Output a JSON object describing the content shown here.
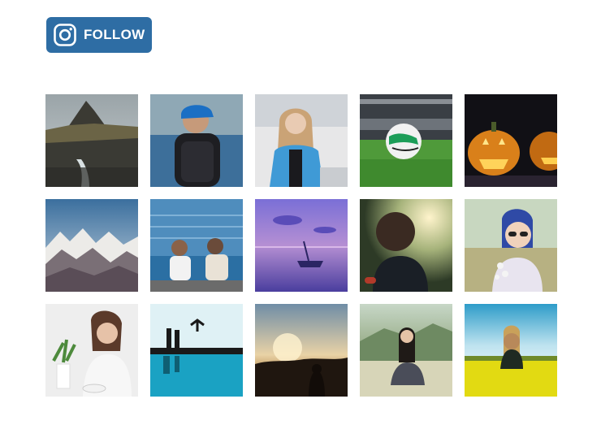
{
  "follow_button": {
    "label": "FOLLOW",
    "icon": "instagram-icon",
    "background": "#2e6da4"
  },
  "gallery": {
    "photos": [
      {
        "subject": "mountain-river"
      },
      {
        "subject": "hiker-backpack"
      },
      {
        "subject": "girl-snow"
      },
      {
        "subject": "soccer-ball"
      },
      {
        "subject": "halloween-pumpkins"
      },
      {
        "subject": "snowy-mountains"
      },
      {
        "subject": "friends-by-sea"
      },
      {
        "subject": "boat-purple-lake"
      },
      {
        "subject": "curly-hair-sunlight"
      },
      {
        "subject": "woman-sunglasses-flowers"
      },
      {
        "subject": "woman-coffee"
      },
      {
        "subject": "jump-reflection"
      },
      {
        "subject": "sunset-silhouette"
      },
      {
        "subject": "woman-in-field"
      },
      {
        "subject": "yellow-flower-field"
      }
    ]
  }
}
